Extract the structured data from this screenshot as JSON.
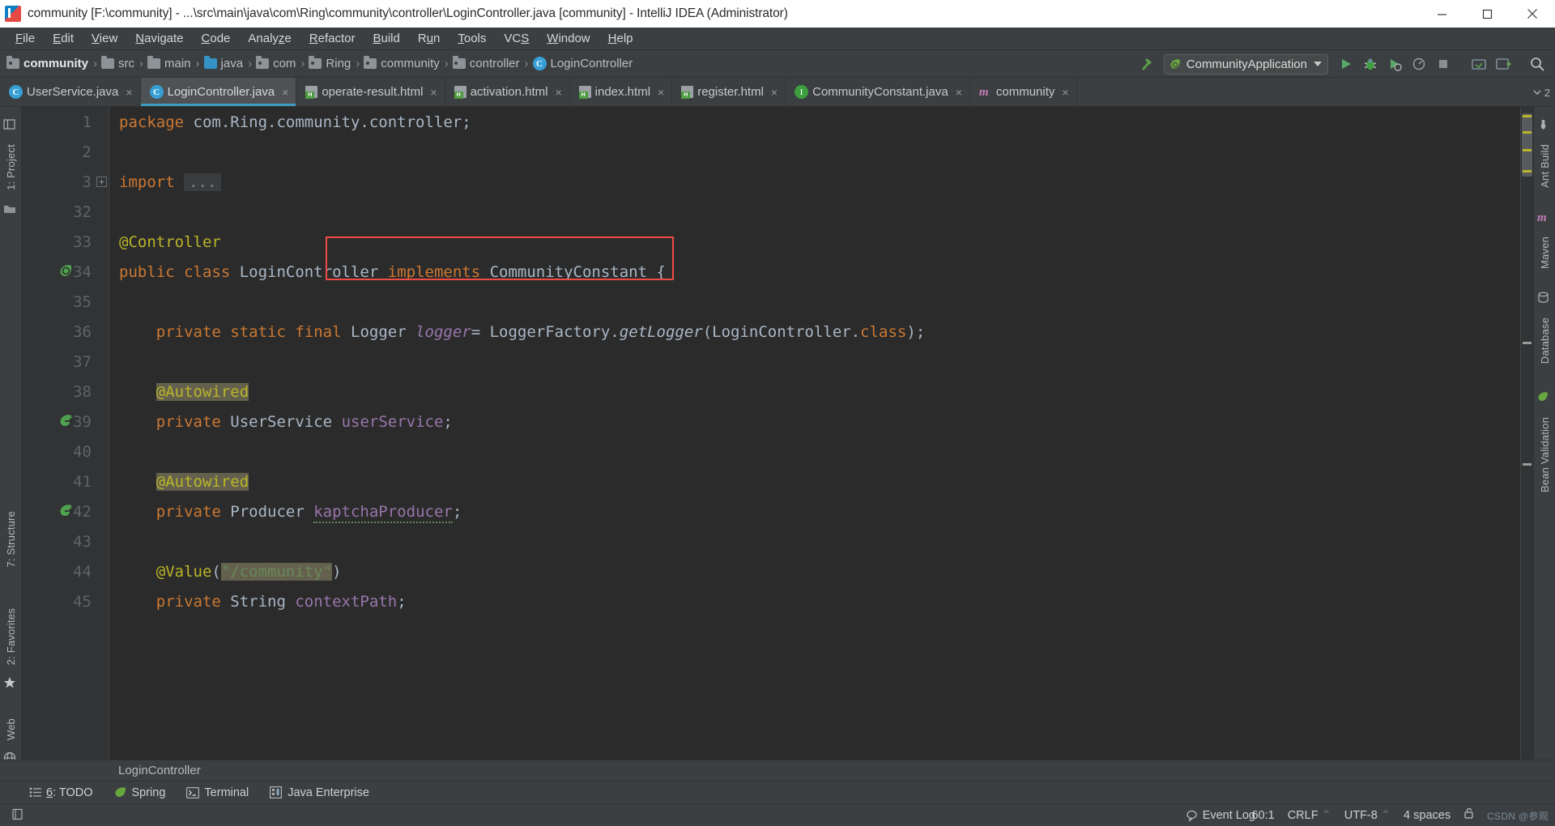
{
  "window": {
    "title": "community [F:\\community] - ...\\src\\main\\java\\com\\Ring\\community\\controller\\LoginController.java [community] - IntelliJ IDEA (Administrator)",
    "app_icon": "intellij-idea-icon",
    "controls": {
      "minimize": "minimize-icon",
      "maximize": "maximize-icon",
      "close": "close-icon"
    }
  },
  "menubar": {
    "items": [
      {
        "label": "File",
        "mnemonic": "F"
      },
      {
        "label": "Edit",
        "mnemonic": "E"
      },
      {
        "label": "View",
        "mnemonic": "V"
      },
      {
        "label": "Navigate",
        "mnemonic": "N"
      },
      {
        "label": "Code",
        "mnemonic": "C"
      },
      {
        "label": "Analyze",
        "mnemonic": "z"
      },
      {
        "label": "Refactor",
        "mnemonic": "R"
      },
      {
        "label": "Build",
        "mnemonic": "B"
      },
      {
        "label": "Run",
        "mnemonic": "u"
      },
      {
        "label": "Tools",
        "mnemonic": "T"
      },
      {
        "label": "VCS",
        "mnemonic": "S"
      },
      {
        "label": "Window",
        "mnemonic": "W"
      },
      {
        "label": "Help",
        "mnemonic": "H"
      }
    ]
  },
  "navbar": {
    "breadcrumbs": [
      {
        "label": "community",
        "icon": "folder-module-icon"
      },
      {
        "label": "src",
        "icon": "folder-icon"
      },
      {
        "label": "main",
        "icon": "folder-icon"
      },
      {
        "label": "java",
        "icon": "folder-source-icon"
      },
      {
        "label": "com",
        "icon": "package-icon"
      },
      {
        "label": "Ring",
        "icon": "package-icon"
      },
      {
        "label": "community",
        "icon": "package-icon"
      },
      {
        "label": "controller",
        "icon": "package-icon"
      },
      {
        "label": "LoginController",
        "icon": "java-class-icon"
      }
    ],
    "separator": "›",
    "run_config": {
      "label": "CommunityApplication",
      "icon": "spring-boot-icon",
      "dropdown": "chevron-down-icon"
    },
    "buttons": [
      {
        "name": "build-project-button",
        "icon": "hammer-icon"
      },
      {
        "name": "run-button",
        "icon": "run-icon"
      },
      {
        "name": "debug-button",
        "icon": "debug-icon"
      },
      {
        "name": "run-with-coverage-button",
        "icon": "coverage-icon"
      },
      {
        "name": "profile-button",
        "icon": "profiler-icon"
      },
      {
        "name": "stop-button",
        "icon": "stop-icon"
      },
      {
        "name": "update-project-button",
        "icon": "vcs-update-icon"
      },
      {
        "name": "commit-button",
        "icon": "vcs-commit-icon"
      },
      {
        "name": "search-everywhere-button",
        "icon": "search-icon"
      }
    ]
  },
  "tabs": {
    "close_glyph": "×",
    "items": [
      {
        "label": "UserService.java",
        "icon": "java-class-icon",
        "active": false
      },
      {
        "label": "LoginController.java",
        "icon": "java-class-icon",
        "active": true
      },
      {
        "label": "operate-result.html",
        "icon": "html-file-icon",
        "active": false
      },
      {
        "label": "activation.html",
        "icon": "html-file-icon",
        "active": false
      },
      {
        "label": "index.html",
        "icon": "html-file-icon",
        "active": false
      },
      {
        "label": "register.html",
        "icon": "html-file-icon",
        "active": false
      },
      {
        "label": "CommunityConstant.java",
        "icon": "java-interface-icon",
        "active": false
      },
      {
        "label": "community",
        "icon": "maven-icon",
        "active": false
      }
    ],
    "overflow_count": "2"
  },
  "left_strip": {
    "top": [
      {
        "label": "1: Project",
        "name": "tool-window-project"
      }
    ],
    "middle": [
      {
        "label": "7: Structure",
        "name": "tool-window-structure"
      },
      {
        "label": "2: Favorites",
        "name": "tool-window-favorites"
      },
      {
        "label": "Web",
        "name": "tool-window-web"
      }
    ]
  },
  "right_strip": {
    "items": [
      {
        "label": "Ant Build",
        "name": "tool-window-ant-build"
      },
      {
        "label": "Maven",
        "name": "tool-window-maven"
      },
      {
        "label": "Database",
        "name": "tool-window-database"
      },
      {
        "label": "Bean Validation",
        "name": "tool-window-bean-validation"
      }
    ]
  },
  "editor": {
    "file": "LoginController.java",
    "breadcrumb": "LoginController",
    "highlight_box": {
      "color": "#ef4b45",
      "target": "implements CommunityConstant {"
    },
    "lines": [
      {
        "no": "1",
        "tokens": [
          {
            "t": "package ",
            "c": "kw"
          },
          {
            "t": "com.Ring.community.controller;",
            "c": "cls"
          }
        ]
      },
      {
        "no": "2",
        "tokens": []
      },
      {
        "no": "3",
        "fold": "+",
        "tokens": [
          {
            "t": "import ",
            "c": "kw"
          },
          {
            "t": "...",
            "c": "fold"
          }
        ]
      },
      {
        "no": "32",
        "tokens": []
      },
      {
        "no": "33",
        "tokens": [
          {
            "t": "@Controller",
            "c": "ann"
          }
        ]
      },
      {
        "no": "34",
        "gutter_icon": "class-marker-icon",
        "tokens": [
          {
            "t": "public ",
            "c": "kw"
          },
          {
            "t": "class ",
            "c": "kw"
          },
          {
            "t": "LoginController ",
            "c": "cls"
          },
          {
            "t": "implements ",
            "c": "kw"
          },
          {
            "t": "CommunityConstant {",
            "c": "cls"
          }
        ]
      },
      {
        "no": "35",
        "tokens": []
      },
      {
        "no": "36",
        "tokens": [
          {
            "t": "    private ",
            "c": "kw"
          },
          {
            "t": "static ",
            "c": "kw"
          },
          {
            "t": "final ",
            "c": "kw"
          },
          {
            "t": "Logger ",
            "c": "cls"
          },
          {
            "t": "logger",
            "c": "ital"
          },
          {
            "t": "= LoggerFactory.",
            "c": "cls"
          },
          {
            "t": "getLogger",
            "c": "mth"
          },
          {
            "t": "(LoginController.",
            "c": "cls"
          },
          {
            "t": "class",
            "c": "kw"
          },
          {
            "t": ");",
            "c": "cls"
          }
        ]
      },
      {
        "no": "37",
        "tokens": []
      },
      {
        "no": "38",
        "tokens": [
          {
            "t": "    ",
            "c": "cls"
          },
          {
            "t": "@Autowired",
            "c": "annhl"
          }
        ]
      },
      {
        "no": "39",
        "gutter_icon": "bean-marker-icon",
        "tokens": [
          {
            "t": "    private ",
            "c": "kw"
          },
          {
            "t": "UserService ",
            "c": "cls"
          },
          {
            "t": "userService",
            "c": "fld"
          },
          {
            "t": ";",
            "c": "cls"
          }
        ]
      },
      {
        "no": "40",
        "tokens": []
      },
      {
        "no": "41",
        "tokens": [
          {
            "t": "    ",
            "c": "cls"
          },
          {
            "t": "@Autowired",
            "c": "annhl"
          }
        ]
      },
      {
        "no": "42",
        "gutter_icon": "bean-marker-icon",
        "tokens": [
          {
            "t": "    private ",
            "c": "kw"
          },
          {
            "t": "Producer ",
            "c": "cls"
          },
          {
            "t": "kaptchaProducer",
            "c": "fldsq"
          },
          {
            "t": ";",
            "c": "cls"
          }
        ]
      },
      {
        "no": "43",
        "tokens": []
      },
      {
        "no": "44",
        "tokens": [
          {
            "t": "    ",
            "c": "cls"
          },
          {
            "t": "@Value",
            "c": "ann"
          },
          {
            "t": "(",
            "c": "cls"
          },
          {
            "t": "\"/community\"",
            "c": "sthl"
          },
          {
            "t": ")",
            "c": "cls"
          }
        ]
      },
      {
        "no": "45",
        "tokens": [
          {
            "t": "    private ",
            "c": "kw"
          },
          {
            "t": "String ",
            "c": "cls"
          },
          {
            "t": "contextPath",
            "c": "fld"
          },
          {
            "t": ";",
            "c": "cls"
          }
        ]
      }
    ]
  },
  "bottom_bar": {
    "items": [
      {
        "label": "6: TODO",
        "mnemonic": "6",
        "icon": "todo-icon"
      },
      {
        "label": "Spring",
        "icon": "spring-icon"
      },
      {
        "label": "Terminal",
        "icon": "terminal-icon"
      },
      {
        "label": "Java Enterprise",
        "icon": "java-enterprise-icon"
      }
    ]
  },
  "status_bar": {
    "left_icon": "show-toolwindow-bars-icon",
    "caret": "60:1",
    "line_separator": "CRLF",
    "encoding": "UTF-8",
    "indent": "4 spaces",
    "event_log": "Event Log",
    "event_log_icon": "balloon-icon",
    "lock_icon": "unlocked-icon",
    "watermark": "CSDN @参观"
  },
  "colors": {
    "accent": "#3d9bbf",
    "editor_bg": "#2b2b2b",
    "chrome_bg": "#3c3f41",
    "gutter_bg": "#313335",
    "highlight_red": "#ef4b45",
    "keyword": "#cc7832",
    "annotation": "#bbb529",
    "field": "#9876aa",
    "string": "#6a8759",
    "text": "#a9b7c6"
  }
}
